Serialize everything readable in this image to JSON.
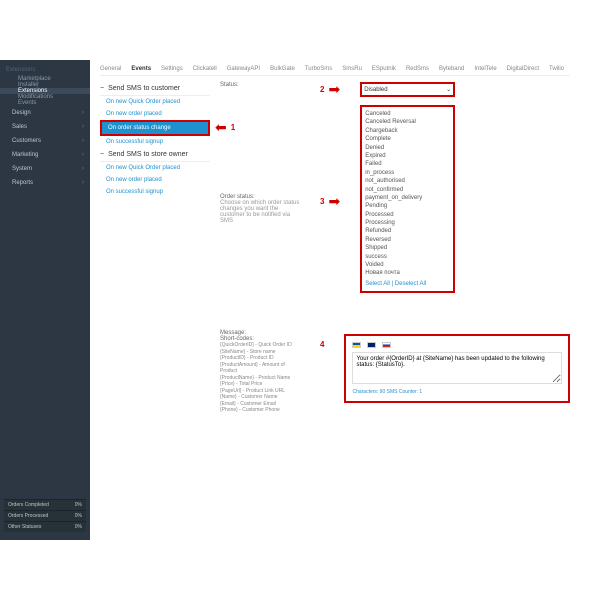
{
  "sidebar": {
    "section": "Extensions",
    "items": [
      "Marketplace",
      "Installer",
      "Extensions",
      "Modifications",
      "Events"
    ],
    "nav": [
      "Design",
      "Sales",
      "Customers",
      "Marketing",
      "System",
      "Reports"
    ],
    "stats": [
      {
        "label": "Orders Completed",
        "val": "0%"
      },
      {
        "label": "Orders Processed",
        "val": "0%"
      },
      {
        "label": "Other Statuses",
        "val": "0%"
      }
    ]
  },
  "tabs": [
    "General",
    "Events",
    "Settings",
    "Clickatell",
    "GatewayAPI",
    "BulkGate",
    "TurboSms",
    "SmsRu",
    "ESputnik",
    "RedSms",
    "Byteband",
    "IntelTele",
    "DigitalDirect",
    "Twilio"
  ],
  "active_tab": "Events",
  "customer_section": "Send SMS to customer",
  "owner_section": "Send SMS to store owner",
  "events_customer": [
    "On new Quick Order placed",
    "On new order placed",
    "On order status change",
    "On successful signup"
  ],
  "events_owner": [
    "On new Quick Order placed",
    "On new order placed",
    "On successful signup"
  ],
  "status_label": "Status:",
  "status_value": "Disabled",
  "order_status_label": "Order status:",
  "order_status_desc": "Choose on which order status changes you want the customer to be notified via SMS",
  "statuses": [
    "Canceled",
    "Canceled Reversal",
    "Chargeback",
    "Complete",
    "Denied",
    "Expired",
    "Failed",
    "in_process",
    "not_authorised",
    "not_confirmed",
    "payment_on_delivery",
    "Pending",
    "Processed",
    "Processing",
    "Refunded",
    "Reversed",
    "Shipped",
    "success",
    "Voided",
    "Новая почта"
  ],
  "select_all": "Select All",
  "deselect_all": "Deselect All",
  "message_label": "Message:",
  "shortcodes_label": "Short-codes:",
  "shortcodes": [
    "{QuickOrderID} - Quick Order ID",
    "{SiteName} - Store name",
    "{ProductID} - Product ID",
    "{ProductAmount} - Amount of Product",
    "{ProductName} - Product Name",
    "{Price} - Total Price",
    "{PageUrl} - Product Link URL",
    "{Name} - Customer Name",
    "{Email} - Customer Email",
    "{Phone} - Customer Phone"
  ],
  "message_text": "Your order #{OrderID} at {SiteName} has been updated to the following status: {StatusTo}.",
  "counter": "Characters: 90    SMS Counter: 1",
  "anno": {
    "1": "1",
    "2": "2",
    "3": "3",
    "4": "4"
  }
}
